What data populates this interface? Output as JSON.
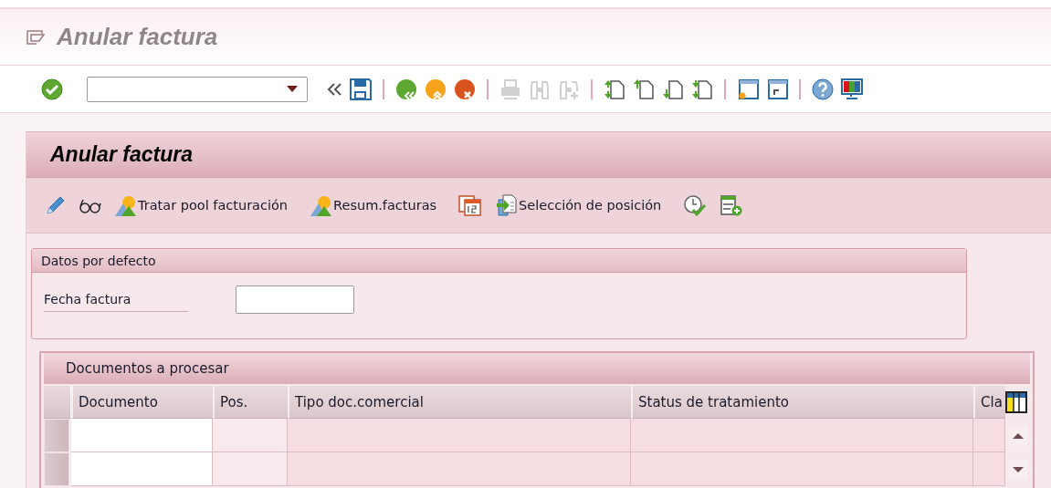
{
  "window": {
    "title": "Anular factura"
  },
  "system_toolbar": {
    "buttons": [
      {
        "disabled": false
      },
      {
        "disabled": false
      },
      {
        "disabled": false
      },
      {
        "disabled": false
      },
      {
        "disabled": false
      },
      {
        "disabled": false
      },
      {
        "disabled": true
      },
      {
        "disabled": true
      },
      {
        "disabled": true
      },
      {
        "disabled": false
      },
      {
        "disabled": false
      },
      {
        "disabled": false
      },
      {
        "disabled": false
      },
      {
        "disabled": false
      },
      {
        "disabled": false
      },
      {
        "disabled": false
      },
      {
        "disabled": false
      }
    ]
  },
  "panel": {
    "title": "Anular factura",
    "app_toolbar": [
      {
        "label": "Tratar pool facturación"
      },
      {
        "label": "Resum.facturas"
      },
      {
        "label": "Selección de posición"
      }
    ],
    "defaults_group": {
      "title": "Datos por defecto",
      "fields": [
        {
          "label": "Fecha factura"
        }
      ]
    },
    "table": {
      "title": "Documentos a procesar",
      "columns": [
        {
          "label": "Documento",
          "editable": true
        },
        {
          "label": "Pos.",
          "editable": false
        },
        {
          "label": "Tipo doc.comercial",
          "editable": false
        },
        {
          "label": "Status de tratamiento",
          "editable": false
        },
        {
          "label": "Cla",
          "editable": false
        }
      ],
      "rows": [
        {
          "selected": false
        },
        {
          "selected": false
        }
      ]
    }
  }
}
